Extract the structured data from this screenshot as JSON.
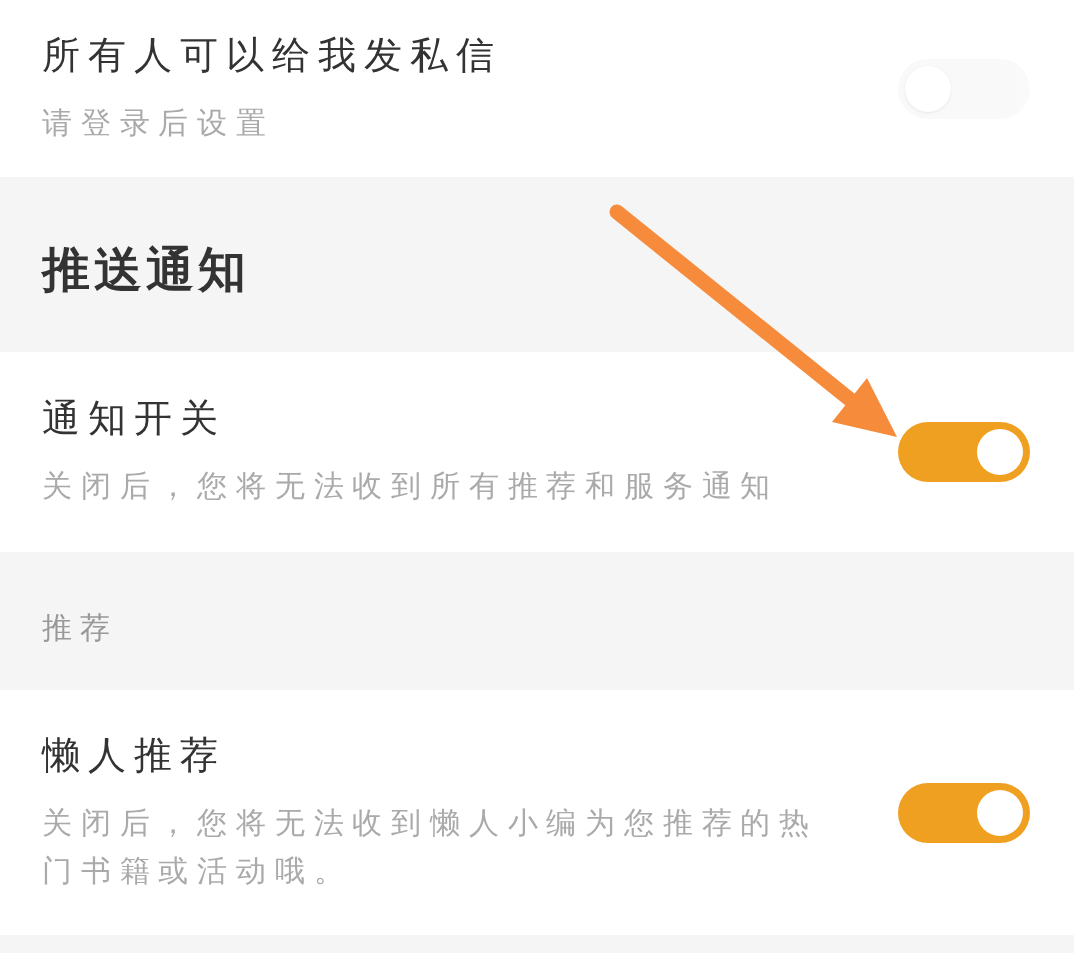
{
  "rows": [
    {
      "kind": "toggle",
      "title": "所有人可以给我发私信",
      "subtitle": "请登录后设置",
      "on": false,
      "disabled": true
    },
    {
      "kind": "section",
      "title": "推送通知"
    },
    {
      "kind": "toggle",
      "title": "通知开关",
      "subtitle": "关闭后，您将无法收到所有推荐和服务通知",
      "on": true,
      "disabled": false
    },
    {
      "kind": "group",
      "title": "推荐"
    },
    {
      "kind": "toggle",
      "title": "懒人推荐",
      "subtitle": "关闭后，您将无法收到懒人小编为您推荐的热门书籍或活动哦。",
      "on": true,
      "disabled": false
    }
  ]
}
